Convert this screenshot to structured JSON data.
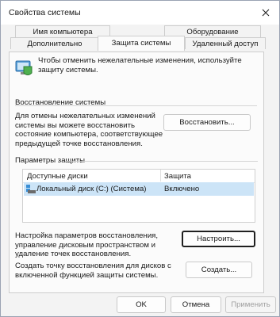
{
  "window": {
    "title": "Свойства системы"
  },
  "tabs": {
    "row1": [
      "Имя компьютера",
      "Оборудование"
    ],
    "row2": [
      "Дополнительно",
      "Защита системы",
      "Удаленный доступ"
    ],
    "active": "Защита системы"
  },
  "intro": {
    "text": "Чтобы отменить нежелательные изменения, используйте защиту системы.",
    "icon": "system-protection-icon"
  },
  "restore": {
    "heading": "Восстановление системы",
    "description": "Для отмены нежелательных изменений системы вы можете восстановить состояние компьютера, соответствующее предыдущей точке восстановления.",
    "button": "Восстановить..."
  },
  "protection": {
    "heading": "Параметры защиты",
    "columns": [
      "Доступные диски",
      "Защита"
    ],
    "rows": [
      {
        "drive": "Локальный диск (C:) (Система)",
        "status": "Включено",
        "icon": "drive-icon"
      }
    ],
    "configure_text": "Настройка параметров восстановления, управление дисковым пространством и удаление точек восстановления.",
    "configure_button": "Настроить...",
    "create_text": "Создать точку восстановления для дисков с включенной функцией защиты системы.",
    "create_button": "Создать..."
  },
  "footer": {
    "ok": "OK",
    "cancel": "Отмена",
    "apply": "Применить"
  }
}
